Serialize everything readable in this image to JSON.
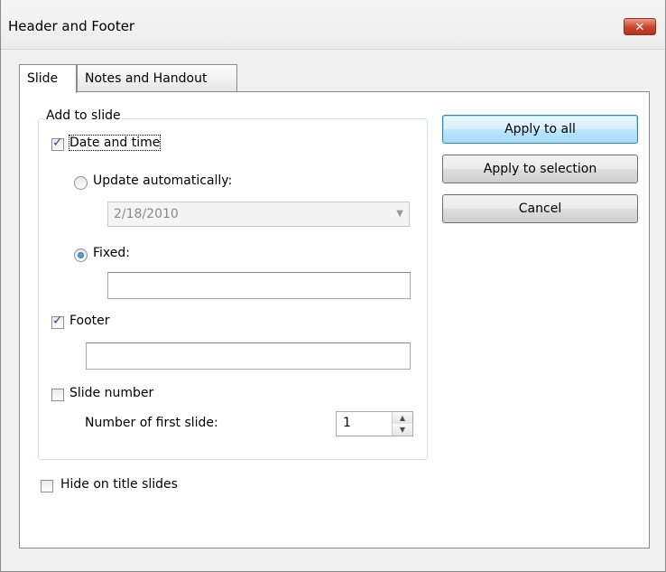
{
  "window": {
    "title": "Header and Footer",
    "close_icon": "close-icon"
  },
  "tabs": [
    {
      "label": "Slide",
      "active": true
    },
    {
      "label": "Notes and Handout",
      "active": false
    }
  ],
  "group": {
    "label": "Add to slide",
    "date_time": {
      "label": "Date and time",
      "checked": true
    },
    "update_auto": {
      "label": "Update automatically:",
      "selected": false
    },
    "date_combo": {
      "value": "2/18/2010",
      "enabled": false
    },
    "fixed": {
      "label": "Fixed:",
      "selected": true,
      "value": ""
    },
    "footer": {
      "label": "Footer",
      "checked": true,
      "value": ""
    },
    "slide_number": {
      "label": "Slide number",
      "checked": false
    },
    "first_slide": {
      "label": "Number of first slide:",
      "value": "1"
    }
  },
  "hide_title": {
    "label": "Hide on title slides",
    "checked": false
  },
  "buttons": {
    "apply_all": "Apply to all",
    "apply_selection": "Apply to selection",
    "cancel": "Cancel"
  }
}
